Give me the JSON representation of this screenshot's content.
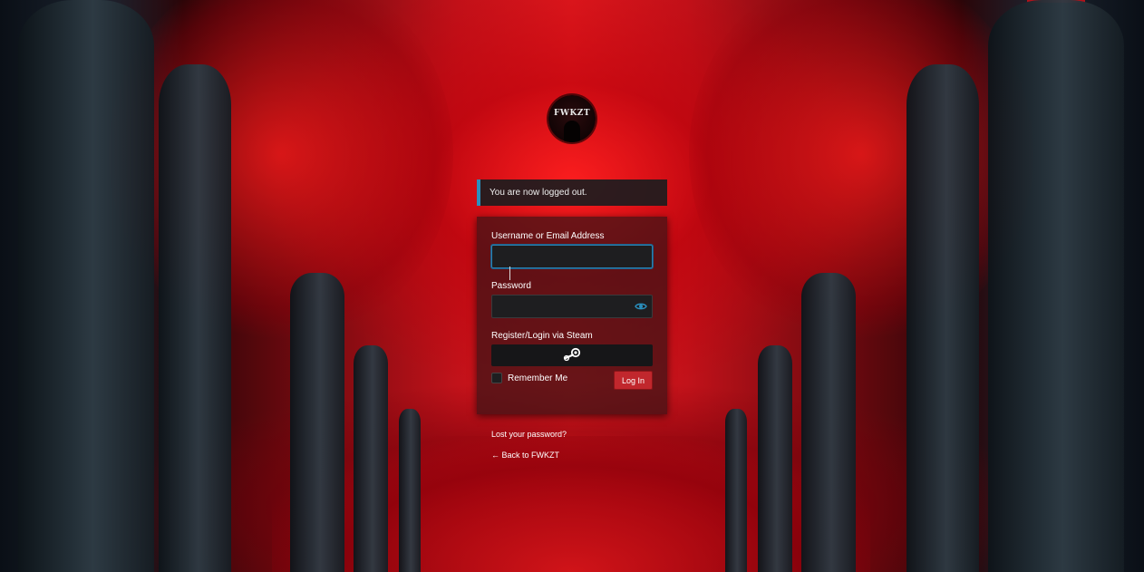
{
  "site": {
    "logo_text": "FWKZT"
  },
  "notice": {
    "message": "You are now logged out."
  },
  "form": {
    "username_label": "Username or Email Address",
    "username_value": "",
    "password_label": "Password",
    "password_value": "",
    "steam_label": "Register/Login via Steam",
    "remember_label": "Remember Me",
    "remember_checked": false,
    "login_button_label": "Log In"
  },
  "links": {
    "lost_password": "Lost your password?",
    "back_to_site": "← Back to FWKZT"
  },
  "colors": {
    "accent_notice_border": "#2a8fbd",
    "login_button": "#c1272d",
    "eye_icon": "#2a8fbd"
  },
  "icons": {
    "password_toggle": "eye-icon",
    "steam": "steam-icon"
  }
}
